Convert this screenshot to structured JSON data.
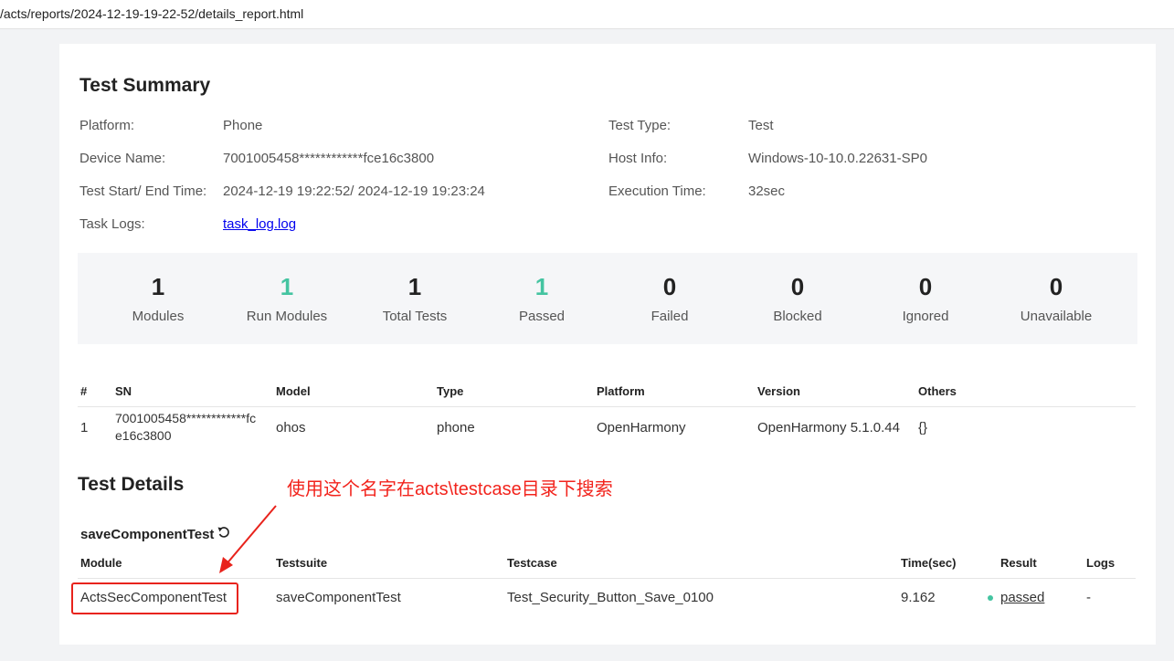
{
  "browser": {
    "url": "/acts/reports/2024-12-19-19-22-52/details_report.html"
  },
  "summary": {
    "title": "Test Summary",
    "left": [
      {
        "label": "Platform:",
        "value": "Phone"
      },
      {
        "label": "Device Name:",
        "value": "7001005458************fce16c3800"
      },
      {
        "label": "Test Start/ End Time:",
        "value": "2024-12-19 19:22:52/ 2024-12-19 19:23:24"
      },
      {
        "label": "Task Logs:",
        "value": "task_log.log"
      }
    ],
    "right": [
      {
        "label": "Test Type:",
        "value": "Test"
      },
      {
        "label": "Host Info:",
        "value": "Windows-10-10.0.22631-SP0"
      },
      {
        "label": "Execution Time:",
        "value": "32sec"
      }
    ]
  },
  "stats": [
    {
      "value": "1",
      "label": "Modules"
    },
    {
      "value": "1",
      "label": "Run Modules"
    },
    {
      "value": "1",
      "label": "Total Tests"
    },
    {
      "value": "1",
      "label": "Passed"
    },
    {
      "value": "0",
      "label": "Failed"
    },
    {
      "value": "0",
      "label": "Blocked"
    },
    {
      "value": "0",
      "label": "Ignored"
    },
    {
      "value": "0",
      "label": "Unavailable"
    }
  ],
  "colors": {
    "accent_green": "#44c4a1",
    "annotation_red": "#f2231c",
    "link": "#0000ee"
  },
  "devices": {
    "headers": [
      "#",
      "SN",
      "Model",
      "Type",
      "Platform",
      "Version",
      "Others"
    ],
    "row": {
      "index": "1",
      "sn_line1": "7001005458************fc",
      "sn_line2": "e16c3800",
      "model": "ohos",
      "type": "phone",
      "platform": "OpenHarmony",
      "version": "OpenHarmony 5.1.0.44",
      "others": "{}"
    }
  },
  "details": {
    "title": "Test Details",
    "annotation": "使用这个名字在acts\\testcase目录下搜索",
    "suite_name": "saveComponentTest",
    "refresh_icon": "refresh-icon",
    "headers": [
      "Module",
      "Testsuite",
      "Testcase",
      "Time(sec)",
      "Result",
      "Logs"
    ],
    "row": {
      "module": "ActsSecComponentTest",
      "testsuite": "saveComponentTest",
      "testcase": "Test_Security_Button_Save_0100",
      "time": "9.162",
      "result": "passed",
      "logs": "-"
    }
  }
}
